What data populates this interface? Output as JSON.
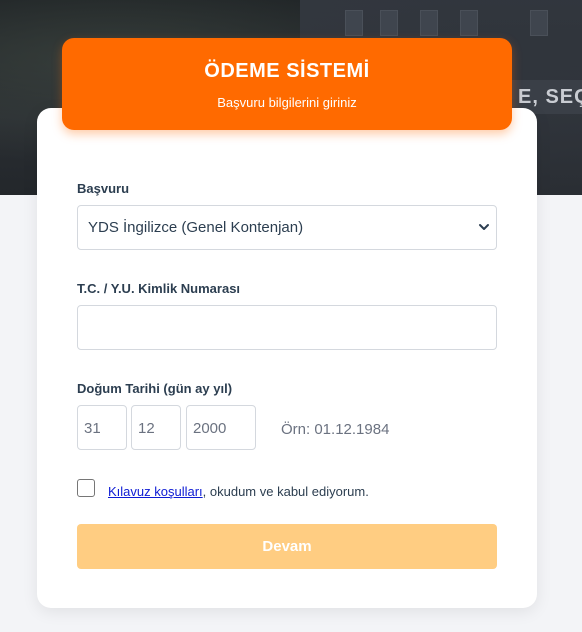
{
  "header": {
    "title": "ÖDEME SİSTEMİ",
    "subtitle": "Başvuru bilgilerini giriniz"
  },
  "background_sign_text": "E, SEÇ",
  "form": {
    "application": {
      "label": "Başvuru",
      "selected_value": "YDS İngilizce (Genel Kontenjan)"
    },
    "id_number": {
      "label": "T.C. / Y.U. Kimlik Numarası",
      "value": ""
    },
    "birth_date": {
      "label": "Doğum Tarihi (gün ay yıl)",
      "day": "31",
      "month": "12",
      "year": "2000",
      "example": "Örn: 01.12.1984"
    },
    "consent": {
      "checked": false,
      "link_text": "Kılavuz koşulları",
      "text": ", okudum ve kabul ediyorum."
    },
    "submit_label": "Devam"
  },
  "colors": {
    "accent": "#ff6a00",
    "button_disabled": "#ffcd82",
    "link": "#0d1bd4"
  }
}
